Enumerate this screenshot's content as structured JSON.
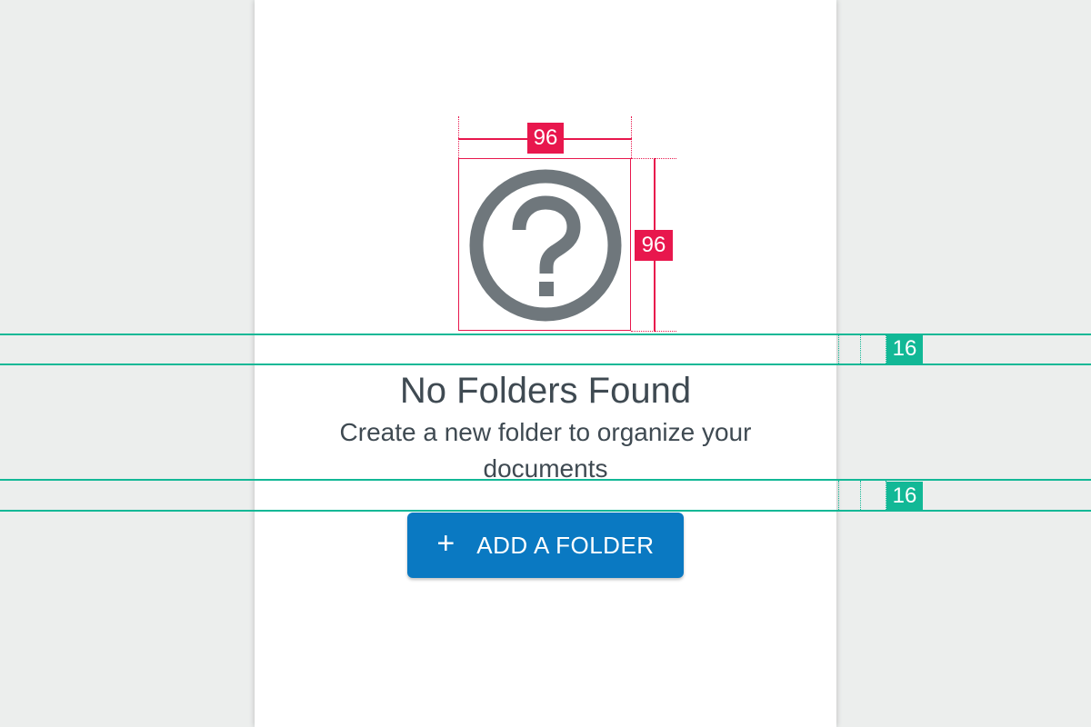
{
  "empty_state": {
    "title": "No Folders Found",
    "subtitle": "Create a new folder to organize your documents",
    "icon": "help-circle-icon",
    "icon_color": "#6f777c"
  },
  "action": {
    "button_label": "ADD A FOLDER",
    "button_icon": "plus-icon",
    "button_color": "#0a79c2"
  },
  "annotations": {
    "icon_width": "96",
    "icon_height": "96",
    "spacing_icon_to_title": "16",
    "spacing_text_to_button": "16",
    "dimension_color": "#e8174d",
    "spacing_color": "#12b896"
  }
}
